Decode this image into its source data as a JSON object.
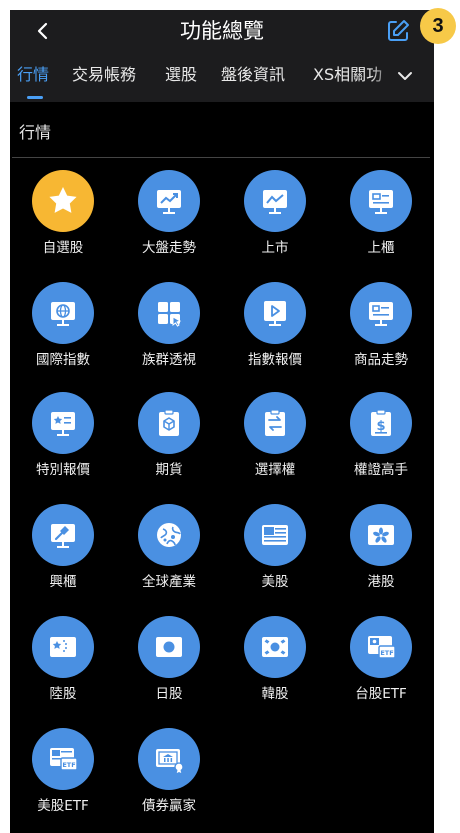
{
  "header": {
    "title": "功能總覽"
  },
  "tabs": [
    "行情",
    "交易帳務",
    "選股",
    "盤後資訊",
    "XS相關功"
  ],
  "section": {
    "title": "行情"
  },
  "items": [
    {
      "label": "自選股",
      "icon": "star-icon"
    },
    {
      "label": "大盤走勢",
      "icon": "trend-board-icon"
    },
    {
      "label": "上市",
      "icon": "line-chart-board-icon"
    },
    {
      "label": "上櫃",
      "icon": "list-board-icon"
    },
    {
      "label": "國際指數",
      "icon": "globe-board-icon"
    },
    {
      "label": "族群透視",
      "icon": "group-view-icon"
    },
    {
      "label": "指數報價",
      "icon": "play-board-icon"
    },
    {
      "label": "商品走勢",
      "icon": "product-board-icon"
    },
    {
      "label": "特別報價",
      "icon": "special-quote-icon"
    },
    {
      "label": "期貨",
      "icon": "futures-clipboard-icon"
    },
    {
      "label": "選擇權",
      "icon": "options-clipboard-icon"
    },
    {
      "label": "權證高手",
      "icon": "warrant-clipboard-icon"
    },
    {
      "label": "興櫃",
      "icon": "gavel-board-icon"
    },
    {
      "label": "全球產業",
      "icon": "global-industry-icon"
    },
    {
      "label": "美股",
      "icon": "us-flag-icon"
    },
    {
      "label": "港股",
      "icon": "hk-flag-icon"
    },
    {
      "label": "陸股",
      "icon": "china-flag-icon"
    },
    {
      "label": "日股",
      "icon": "japan-flag-icon"
    },
    {
      "label": "韓股",
      "icon": "korea-flag-icon"
    },
    {
      "label": "台股ETF",
      "icon": "tw-etf-icon"
    },
    {
      "label": "美股ETF",
      "icon": "us-etf-icon"
    },
    {
      "label": "債券贏家",
      "icon": "bond-icon"
    }
  ],
  "badge": "3",
  "colors": {
    "accent": "#4a9ff5",
    "icon_blue": "#4a90e2",
    "icon_gold": "#f7b733",
    "badge": "#f7c948"
  }
}
